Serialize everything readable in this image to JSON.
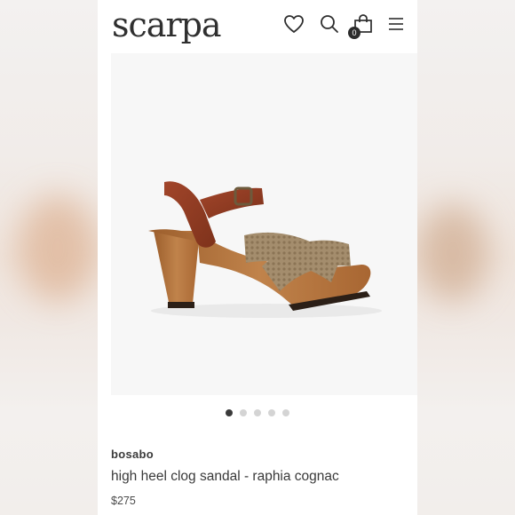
{
  "header": {
    "logo": "scarpa",
    "icons": [
      "heart-icon",
      "search-icon",
      "shopping-bag-icon",
      "hamburger-menu-icon"
    ],
    "cart_count": "0"
  },
  "product": {
    "brand": "bosabo",
    "title": "high heel clog sandal - raphia cognac",
    "price": "$275",
    "image_count": 5,
    "active_image": 1
  },
  "colors": {
    "text": "#3a3a3a",
    "dot_active": "#3a3a3a",
    "dot_inactive": "#d4d4d4",
    "leather": "#8e3b22",
    "wood": "#b7773f",
    "raphia": "#a28c6c"
  }
}
